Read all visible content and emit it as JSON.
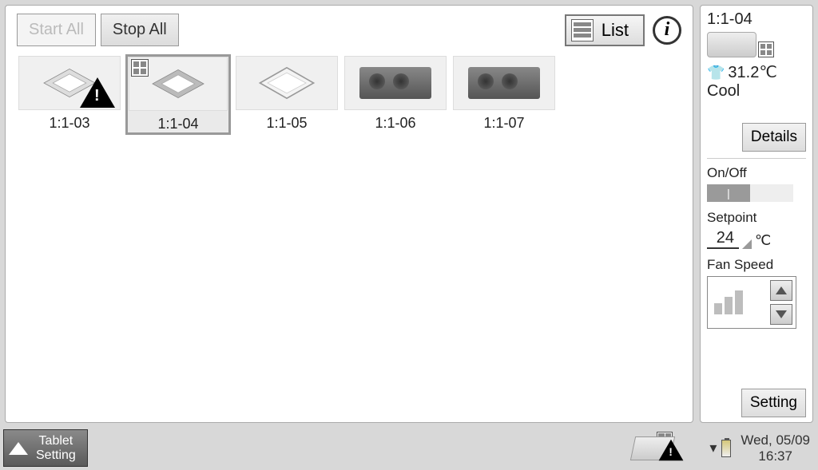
{
  "toolbar": {
    "start_all": "Start All",
    "stop_all": "Stop All",
    "list_label": "List"
  },
  "units": [
    {
      "id": "1:1-03",
      "type": "cassette",
      "alert": true,
      "selected": false
    },
    {
      "id": "1:1-04",
      "type": "cassette",
      "alert": false,
      "selected": true,
      "badge": true
    },
    {
      "id": "1:1-05",
      "type": "panel",
      "alert": false,
      "selected": false
    },
    {
      "id": "1:1-06",
      "type": "duct",
      "alert": false,
      "selected": false
    },
    {
      "id": "1:1-07",
      "type": "duct",
      "alert": false,
      "selected": false
    }
  ],
  "side": {
    "name": "1:1-04",
    "room_temp": "31.2℃",
    "mode": "Cool",
    "details": "Details",
    "onoff_label": "On/Off",
    "onoff_state": "|",
    "setpoint_label": "Setpoint",
    "setpoint_value": "24",
    "setpoint_unit": "℃",
    "fan_label": "Fan Speed",
    "setting": "Setting"
  },
  "bottom": {
    "tablet_setting_l1": "Tablet",
    "tablet_setting_l2": "Setting",
    "date": "Wed, 05/09",
    "time": "16:37"
  }
}
